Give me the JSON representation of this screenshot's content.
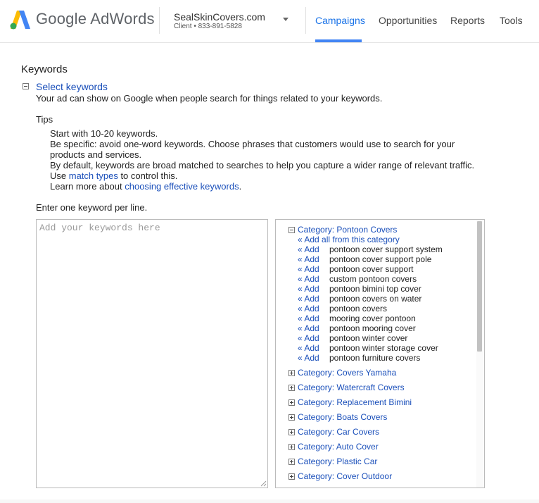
{
  "header": {
    "brand": "Google AdWords",
    "account_name": "SealSkinCovers.com",
    "account_sub": "Client  •  833-891-5828",
    "nav": [
      "Campaigns",
      "Opportunities",
      "Reports",
      "Tools"
    ],
    "active_nav": "Campaigns",
    "logo_colors": [
      "#fbbc04",
      "#4285f4",
      "#34a853"
    ]
  },
  "keywords": {
    "title": "Keywords",
    "select_link": "Select keywords",
    "description": "Your ad can show on Google when people search for things related to your keywords.",
    "tips_heading": "Tips",
    "tips": {
      "line1": "Start with 10-20 keywords.",
      "line2": "Be specific: avoid one-word keywords. Choose phrases that customers would use to search for your",
      "line3": "products and services.",
      "line4": "By default, keywords are broad matched to searches to help you capture a wider range of relevant traffic.",
      "line5_pre": "Use ",
      "line5_link": "match types",
      "line5_post": " to control this.",
      "line6_pre": "Learn more about ",
      "line6_link": "choosing effective keywords",
      "line6_post": "."
    },
    "enter_label": "Enter one keyword per line.",
    "input_placeholder": "Add your keywords here",
    "input_value": ""
  },
  "suggestions": {
    "open_category": "Category: Pontoon Covers",
    "add_all": "« Add all from this category",
    "add_label": "« Add",
    "items": [
      "pontoon cover support system",
      "pontoon cover support pole",
      "pontoon cover support",
      "custom pontoon covers",
      "pontoon bimini top cover",
      "pontoon covers on water",
      "pontoon covers",
      "mooring cover pontoon",
      "pontoon mooring cover",
      "pontoon winter cover",
      "pontoon winter storage cover",
      "pontoon furniture covers"
    ],
    "categories": [
      "Category: Covers Yamaha",
      "Category: Watercraft Covers",
      "Category: Replacement Bimini",
      "Category: Boats Covers",
      "Category: Car Covers",
      "Category: Auto Cover",
      "Category: Plastic Car",
      "Category: Cover Outdoor"
    ]
  }
}
